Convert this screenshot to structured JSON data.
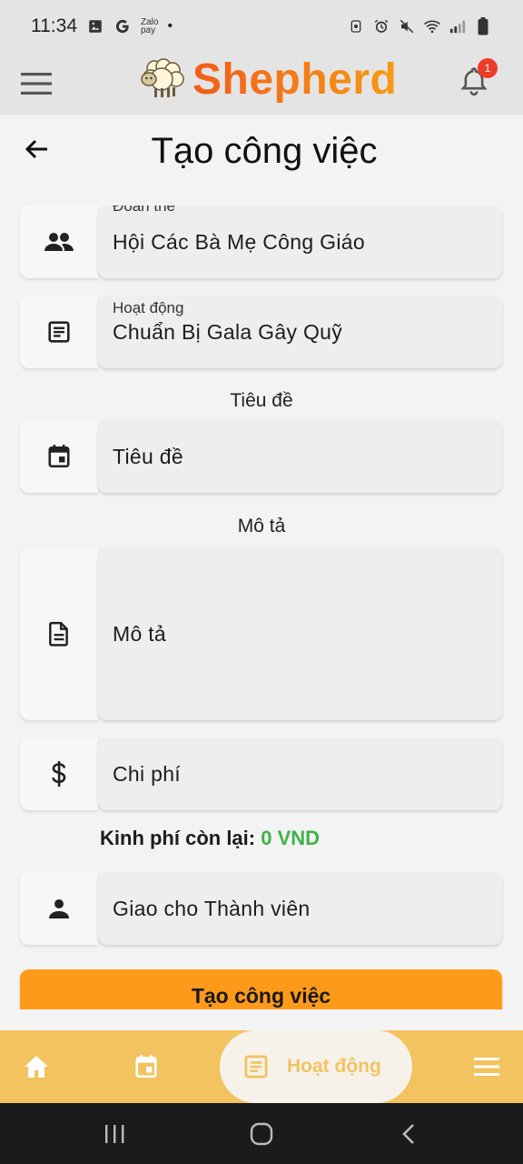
{
  "status_bar": {
    "time": "11:34",
    "zalo_label_top": "Zalo",
    "zalo_label_bottom": "pay",
    "dot": "•"
  },
  "app_bar": {
    "brand_name": "Shepherd",
    "notification_count": "1"
  },
  "page": {
    "title": "Tạo công việc"
  },
  "form": {
    "doan_the": {
      "label": "Đoàn thể",
      "value": "Hội Các Bà Mẹ Công Giáo",
      "icon": "people-icon"
    },
    "hoat_dong": {
      "label": "Hoạt động",
      "value": "Chuẩn Bị Gala Gây Quỹ",
      "icon": "article-icon"
    },
    "title_section": "Tiêu đề",
    "title_field": {
      "placeholder": "Tiêu đề",
      "icon": "event-icon"
    },
    "desc_section": "Mô tả",
    "desc_field": {
      "placeholder": "Mô tả",
      "icon": "description-icon"
    },
    "cost_field": {
      "placeholder": "Chi phí",
      "icon": "dollar-icon"
    },
    "budget_label": "Kinh phí còn lại:",
    "budget_value": "0 VND",
    "assign_field": {
      "placeholder": "Giao cho Thành viên",
      "icon": "person-icon"
    },
    "submit_label": "Tạo công việc"
  },
  "bottom_nav": {
    "active_label": "Hoạt động",
    "items": [
      "home-icon",
      "calendar-icon",
      "activity-icon",
      "menu-icon"
    ]
  },
  "colors": {
    "brand_start": "#f25c1a",
    "brand_end": "#f59b16",
    "submit": "#fe9a1a",
    "nav_bg": "#f2c35f",
    "budget_value": "#3fb24a",
    "badge": "#ee3b2b"
  }
}
